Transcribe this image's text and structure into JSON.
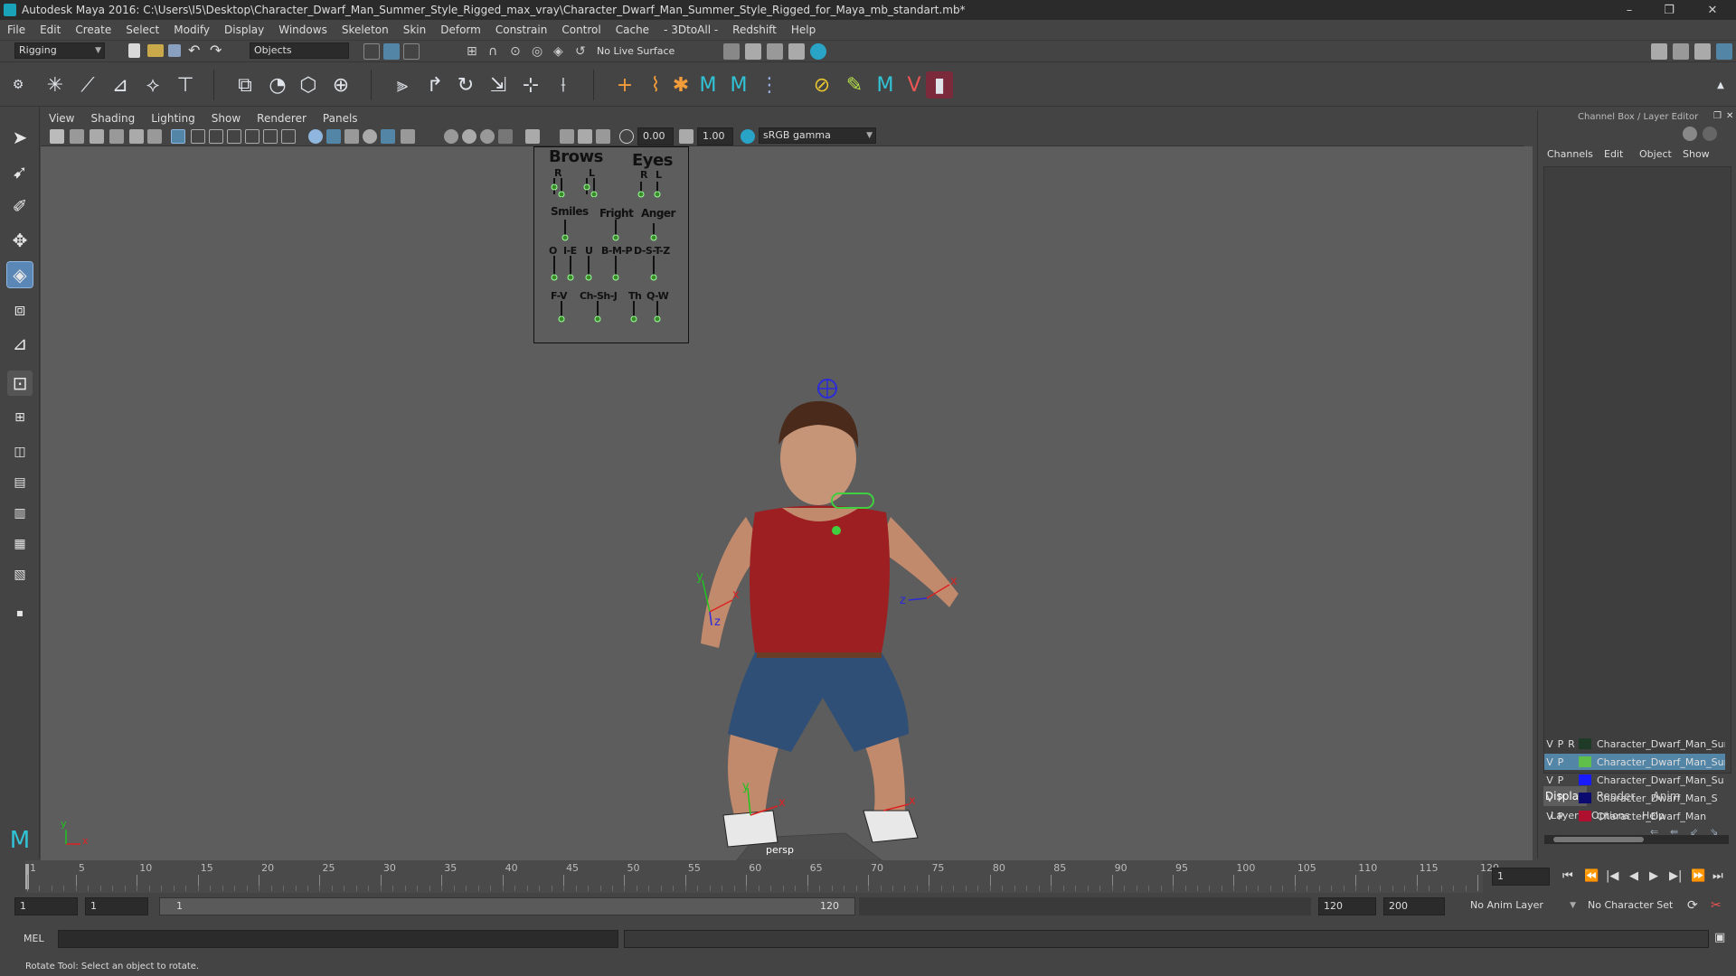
{
  "window": {
    "title": "Autodesk Maya 2016: C:\\Users\\I5\\Desktop\\Character_Dwarf_Man_Summer_Style_Rigged_max_vray\\Character_Dwarf_Man_Summer_Style_Rigged_for_Maya_mb_standart.mb*",
    "minimize": "–",
    "restore": "❐",
    "close": "✕"
  },
  "menubar": [
    "File",
    "Edit",
    "Create",
    "Select",
    "Modify",
    "Display",
    "Windows",
    "Skeleton",
    "Skin",
    "Deform",
    "Constrain",
    "Control",
    "Cache",
    "- 3DtoAll -",
    "Redshift",
    "Help"
  ],
  "statusline": {
    "menuset": "Rigging",
    "select_mode": "Objects",
    "live_surface": "No Live Surface"
  },
  "panel": {
    "menus": [
      "View",
      "Shading",
      "Lighting",
      "Show",
      "Renderer",
      "Panels"
    ],
    "exposure": "0.00",
    "gamma": "1.00",
    "colorspace": "sRGB gamma",
    "camera_label": "persp"
  },
  "face_panel": {
    "brows": "Brows",
    "eyes": "Eyes",
    "r": "R",
    "l": "L",
    "smiles": "Smiles",
    "fright": "Fright",
    "anger": "Anger",
    "o": "O",
    "i_e": "I-E",
    "u": "U",
    "bmp": "B-M-P",
    "dstz": "D-S-T-Z",
    "fv": "F-V",
    "chshj": "Ch-Sh-J",
    "th": "Th",
    "qw": "Q-W"
  },
  "axes": {
    "x": "x",
    "y": "y",
    "z": "z"
  },
  "channelbox": {
    "title": "Channel Box / Layer Editor",
    "menus": [
      "Channels",
      "Edit",
      "Object",
      "Show"
    ],
    "tabs": [
      "Display",
      "Render",
      "Anim"
    ],
    "layer_menus": [
      "Layers",
      "Options",
      "Help"
    ],
    "layers": [
      {
        "v": "V",
        "p": "P",
        "r": "R",
        "color": "#1f3a26",
        "name": "Character_Dwarf_Man_Summ",
        "selected": false
      },
      {
        "v": "V",
        "p": "P",
        "r": "",
        "color": "#5fbf4a",
        "name": "Character_Dwarf_Man_Summ",
        "selected": true
      },
      {
        "v": "V",
        "p": "P",
        "r": "",
        "color": "#1a1aff",
        "name": "Character_Dwarf_Man_Su",
        "selected": false
      },
      {
        "v": "V",
        "p": "P",
        "r": "",
        "color": "#0a0a70",
        "name": "Character_Dwarf_Man_S",
        "selected": false
      },
      {
        "v": "V",
        "p": "P",
        "r": "",
        "color": "#b01030",
        "name": "Character_Dwarf_Man",
        "selected": false
      }
    ]
  },
  "timeline": {
    "ticks": [
      "1",
      "5",
      "10",
      "15",
      "20",
      "25",
      "30",
      "35",
      "40",
      "45",
      "50",
      "55",
      "60",
      "65",
      "70",
      "75",
      "80",
      "85",
      "90",
      "95",
      "100",
      "105",
      "110",
      "115",
      "120"
    ],
    "current_frame": "1"
  },
  "range": {
    "start": "1",
    "playback_start": "1",
    "slider_start": "1",
    "slider_end": "120",
    "playback_end": "120",
    "end": "200",
    "anim_layer": "No Anim Layer",
    "character_set": "No Character Set"
  },
  "cmdline": {
    "lang": "MEL"
  },
  "helpline": {
    "text": "Rotate Tool: Select an object to rotate."
  },
  "colors": {
    "accent": "#5285a6",
    "viewport": "#5d5d5d"
  }
}
